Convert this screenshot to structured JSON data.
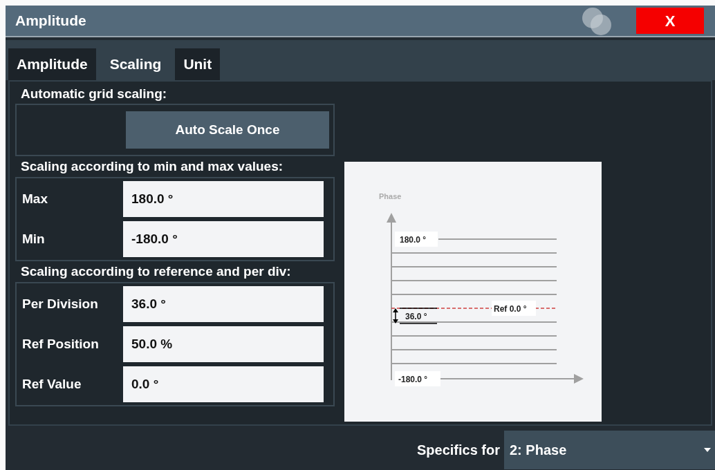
{
  "window": {
    "title": "Amplitude",
    "close": "X"
  },
  "tabs": [
    {
      "label": "Amplitude",
      "selected": false
    },
    {
      "label": "Scaling",
      "selected": true
    },
    {
      "label": "Unit",
      "selected": false
    }
  ],
  "auto_section": {
    "heading": "Automatic grid scaling:",
    "button": "Auto Scale Once"
  },
  "minmax_section": {
    "heading": "Scaling according to min and max values:",
    "fields": [
      {
        "label": "Max",
        "value": "180.0 °"
      },
      {
        "label": "Min",
        "value": "-180.0 °"
      }
    ]
  },
  "ref_section": {
    "heading": "Scaling according to reference and per div:",
    "fields": [
      {
        "label": "Per Division",
        "value": "36.0 °"
      },
      {
        "label": "Ref Position",
        "value": "50.0 %"
      },
      {
        "label": "Ref Value",
        "value": "0.0 °"
      }
    ]
  },
  "diagram": {
    "axis_label": "Phase",
    "top_label": "180.0 °",
    "bottom_label": "-180.0 °",
    "ref_label": "Ref 0.0 °",
    "div_label": "36.0 °"
  },
  "footer": {
    "label": "Specifics for",
    "dropdown": {
      "value": "2: Phase"
    }
  }
}
